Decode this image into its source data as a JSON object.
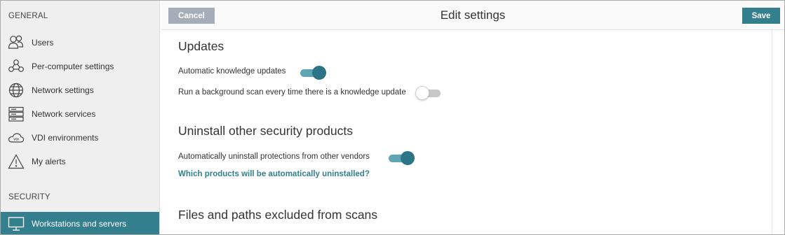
{
  "colors": {
    "accent": "#337f8e",
    "cancel": "#a4adb8",
    "sidebar_bg": "#efefef"
  },
  "sidebar": {
    "general_label": "GENERAL",
    "security_label": "SECURITY",
    "items": [
      {
        "label": "Users",
        "icon": "users-icon"
      },
      {
        "label": "Per-computer settings",
        "icon": "per-computer-settings-icon"
      },
      {
        "label": "Network settings",
        "icon": "globe-icon"
      },
      {
        "label": "Network services",
        "icon": "server-icon"
      },
      {
        "label": "VDI environments",
        "icon": "vdi-cloud-icon"
      },
      {
        "label": "My alerts",
        "icon": "warning-icon"
      }
    ],
    "security_items": [
      {
        "label": "Workstations and servers",
        "icon": "monitor-icon",
        "active": true
      }
    ]
  },
  "header": {
    "cancel_label": "Cancel",
    "title": "Edit settings",
    "save_label": "Save"
  },
  "main": {
    "updates": {
      "heading": "Updates",
      "auto_knowledge_label": "Automatic knowledge updates",
      "auto_knowledge_on": true,
      "background_scan_label": "Run a background scan every time there is a knowledge update",
      "background_scan_on": false
    },
    "uninstall": {
      "heading": "Uninstall other security products",
      "auto_uninstall_label": "Automatically uninstall protections from other vendors",
      "auto_uninstall_on": true,
      "link_text": "Which products will be automatically uninstalled?"
    },
    "exclusions": {
      "heading": "Files and paths excluded from scans"
    }
  }
}
